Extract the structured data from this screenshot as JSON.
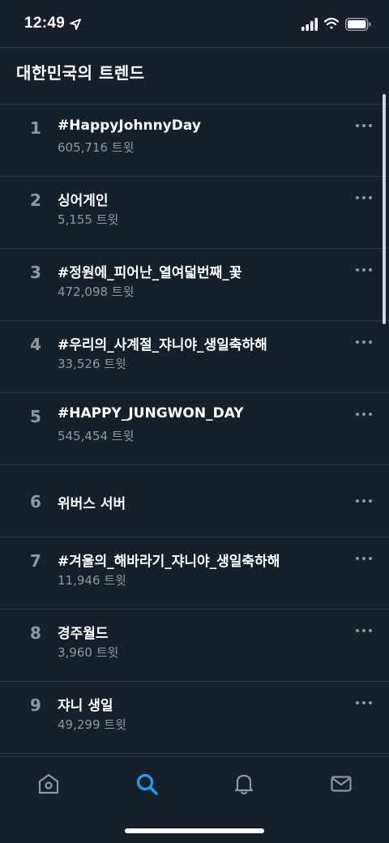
{
  "status_bar": {
    "time": "12:49",
    "icons": [
      "location-arrow-icon",
      "cellular-signal-icon",
      "wifi-icon",
      "battery-icon"
    ]
  },
  "header": {
    "title": "대한민국의 트렌드"
  },
  "trends": [
    {
      "rank": "1",
      "name": "#HappyJohnnyDay",
      "count": "605,716 트윗"
    },
    {
      "rank": "2",
      "name": "싱어게인",
      "count": "5,155 트윗"
    },
    {
      "rank": "3",
      "name": "#정원에_피어난_열여덟번째_꽃",
      "count": "472,098 트윗"
    },
    {
      "rank": "4",
      "name": "#우리의_사계절_쟈니야_생일축하해",
      "count": "33,526 트윗"
    },
    {
      "rank": "5",
      "name": "#HAPPY_JUNGWON_DAY",
      "count": "545,454 트윗"
    },
    {
      "rank": "6",
      "name": "위버스 서버",
      "count": ""
    },
    {
      "rank": "7",
      "name": "#겨울의_해바라기_쟈니야_생일축하해",
      "count": "11,946 트윗"
    },
    {
      "rank": "8",
      "name": "경주월드",
      "count": "3,960 트윗"
    },
    {
      "rank": "9",
      "name": "쟈니 생일",
      "count": "49,299 트윗"
    }
  ],
  "tab_bar": {
    "tabs": [
      "home-icon",
      "search-icon",
      "notifications-icon",
      "messages-icon"
    ],
    "active": "search-icon"
  },
  "colors": {
    "background": "#15202b",
    "divider": "#2a3642",
    "secondary_text": "#8899a6",
    "accent": "#1da1f2"
  }
}
